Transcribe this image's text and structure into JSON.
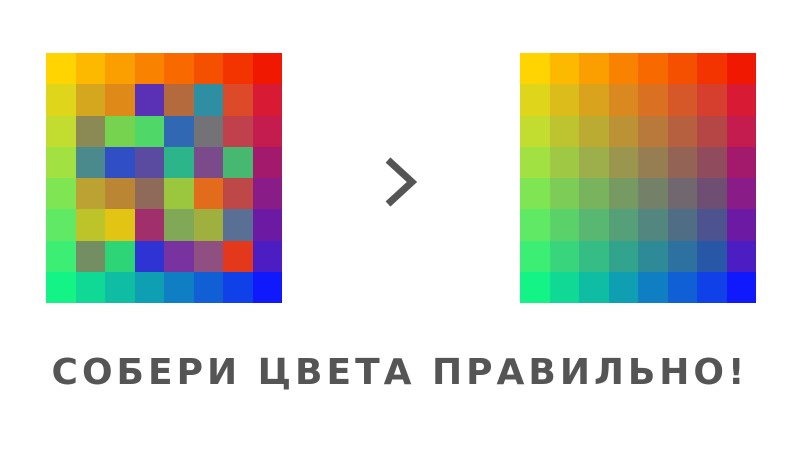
{
  "title": "СОБЕРИ ЦВЕТА ПРАВИЛЬНО!",
  "arrow_icon": "chevron-right-icon",
  "colors": {
    "text": "#555555",
    "arrow": "#555555",
    "background": "#ffffff"
  },
  "puzzle_grid": [
    [
      "#ffd400",
      "#fdb800",
      "#fb9e00",
      "#f98300",
      "#f86a00",
      "#f54f00",
      "#f33300",
      "#f01800"
    ],
    [
      "#dfd51a",
      "#d5a71e",
      "#df8918",
      "#5a31b4",
      "#b56a3e",
      "#2e8fa3",
      "#dc4a29",
      "#d91a35"
    ],
    [
      "#c2dc30",
      "#8c8a54",
      "#76d34f",
      "#4fd868",
      "#3068b4",
      "#737276",
      "#c0404c",
      "#c41c4f"
    ],
    [
      "#a1e142",
      "#4a8a8c",
      "#304fc4",
      "#5a4aa0",
      "#2db58a",
      "#7a4a8a",
      "#46b870",
      "#a31a6c"
    ],
    [
      "#7fe552",
      "#bca232",
      "#bb8634",
      "#8f6a5a",
      "#9bc73f",
      "#e36b1c",
      "#be4848",
      "#8a1c87"
    ],
    [
      "#5fe964",
      "#bdc42a",
      "#e2c414",
      "#a12f6c",
      "#80a856",
      "#9fb03e",
      "#596f93",
      "#6c1aa4"
    ],
    [
      "#3cee74",
      "#738e63",
      "#2ed577",
      "#3033d3",
      "#7833a0",
      "#8f4f80",
      "#e3381c",
      "#4c1dc2"
    ],
    [
      "#14f486",
      "#0fd994",
      "#0fbda2",
      "#0f9fb3",
      "#107ec3",
      "#105fd5",
      "#1040e8",
      "#1019fb"
    ]
  ],
  "solution_grid": [
    [
      "#ffd400",
      "#fdb800",
      "#fb9e00",
      "#f98300",
      "#f86a00",
      "#f54f00",
      "#f33300",
      "#f01800"
    ],
    [
      "#dfd51a",
      "#dcbc1a",
      "#d9a31e",
      "#d9891f",
      "#da7022",
      "#d65728",
      "#d63e2d",
      "#d91a35"
    ],
    [
      "#c2dc30",
      "#bec42f",
      "#bcab32",
      "#bb9236",
      "#b9793a",
      "#b7603f",
      "#b44646",
      "#c41c4f"
    ],
    [
      "#a1e142",
      "#9fc845",
      "#9caf4a",
      "#9a964d",
      "#967d52",
      "#936456",
      "#904b5d",
      "#a31a6c"
    ],
    [
      "#7fe552",
      "#7ccc57",
      "#79b35d",
      "#779a62",
      "#748068",
      "#71676e",
      "#6f4e74",
      "#8a1c87"
    ],
    [
      "#5fe964",
      "#5bd16a",
      "#58b872",
      "#559f79",
      "#52867f",
      "#506d86",
      "#4d538e",
      "#6c1aa4"
    ],
    [
      "#3cee74",
      "#38d57c",
      "#35bd85",
      "#32a38d",
      "#2f8a97",
      "#2c719f",
      "#2957a8",
      "#4c1dc2"
    ],
    [
      "#14f486",
      "#0fd994",
      "#0fbda2",
      "#0f9fb3",
      "#107ec3",
      "#105fd5",
      "#1040e8",
      "#1019fb"
    ]
  ]
}
